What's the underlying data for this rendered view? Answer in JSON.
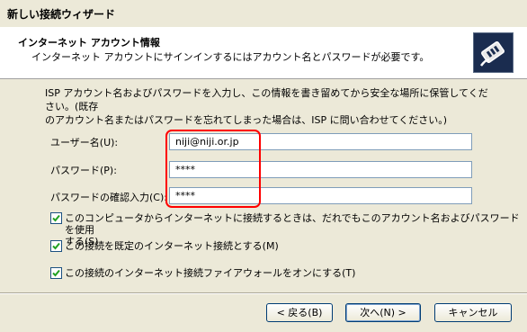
{
  "window": {
    "title": "新しい接続ウィザード"
  },
  "header": {
    "title": "インターネット アカウント情報",
    "subtitle": "インターネット アカウントにサインインするにはアカウント名とパスワードが必要です。"
  },
  "instructions": {
    "line1": "ISP アカウント名およびパスワードを入力し、この情報を書き留めてから安全な場所に保管してください。(既存",
    "line2": "のアカウント名またはパスワードを忘れてしまった場合は、ISP に問い合わせてください。)"
  },
  "form": {
    "username_label": "ユーザー名(U):",
    "username_value": "niji@niji.or.jp",
    "password_label": "パスワード(P):",
    "password_value": "****",
    "confirm_label": "パスワードの確認入力(C):",
    "confirm_value": "****"
  },
  "checkboxes": {
    "cb1_line1": "このコンピュータからインターネットに接続するときは、だれでもこのアカウント名およびパスワードを使用",
    "cb1_line2": "する(S)",
    "cb2": "この接続を既定のインターネット接続とする(M)",
    "cb3": "この接続のインターネット接続ファイアウォールをオンにする(T)"
  },
  "buttons": {
    "back": "< 戻る(B)",
    "next": "次へ(N) >",
    "cancel": "キャンセル"
  }
}
